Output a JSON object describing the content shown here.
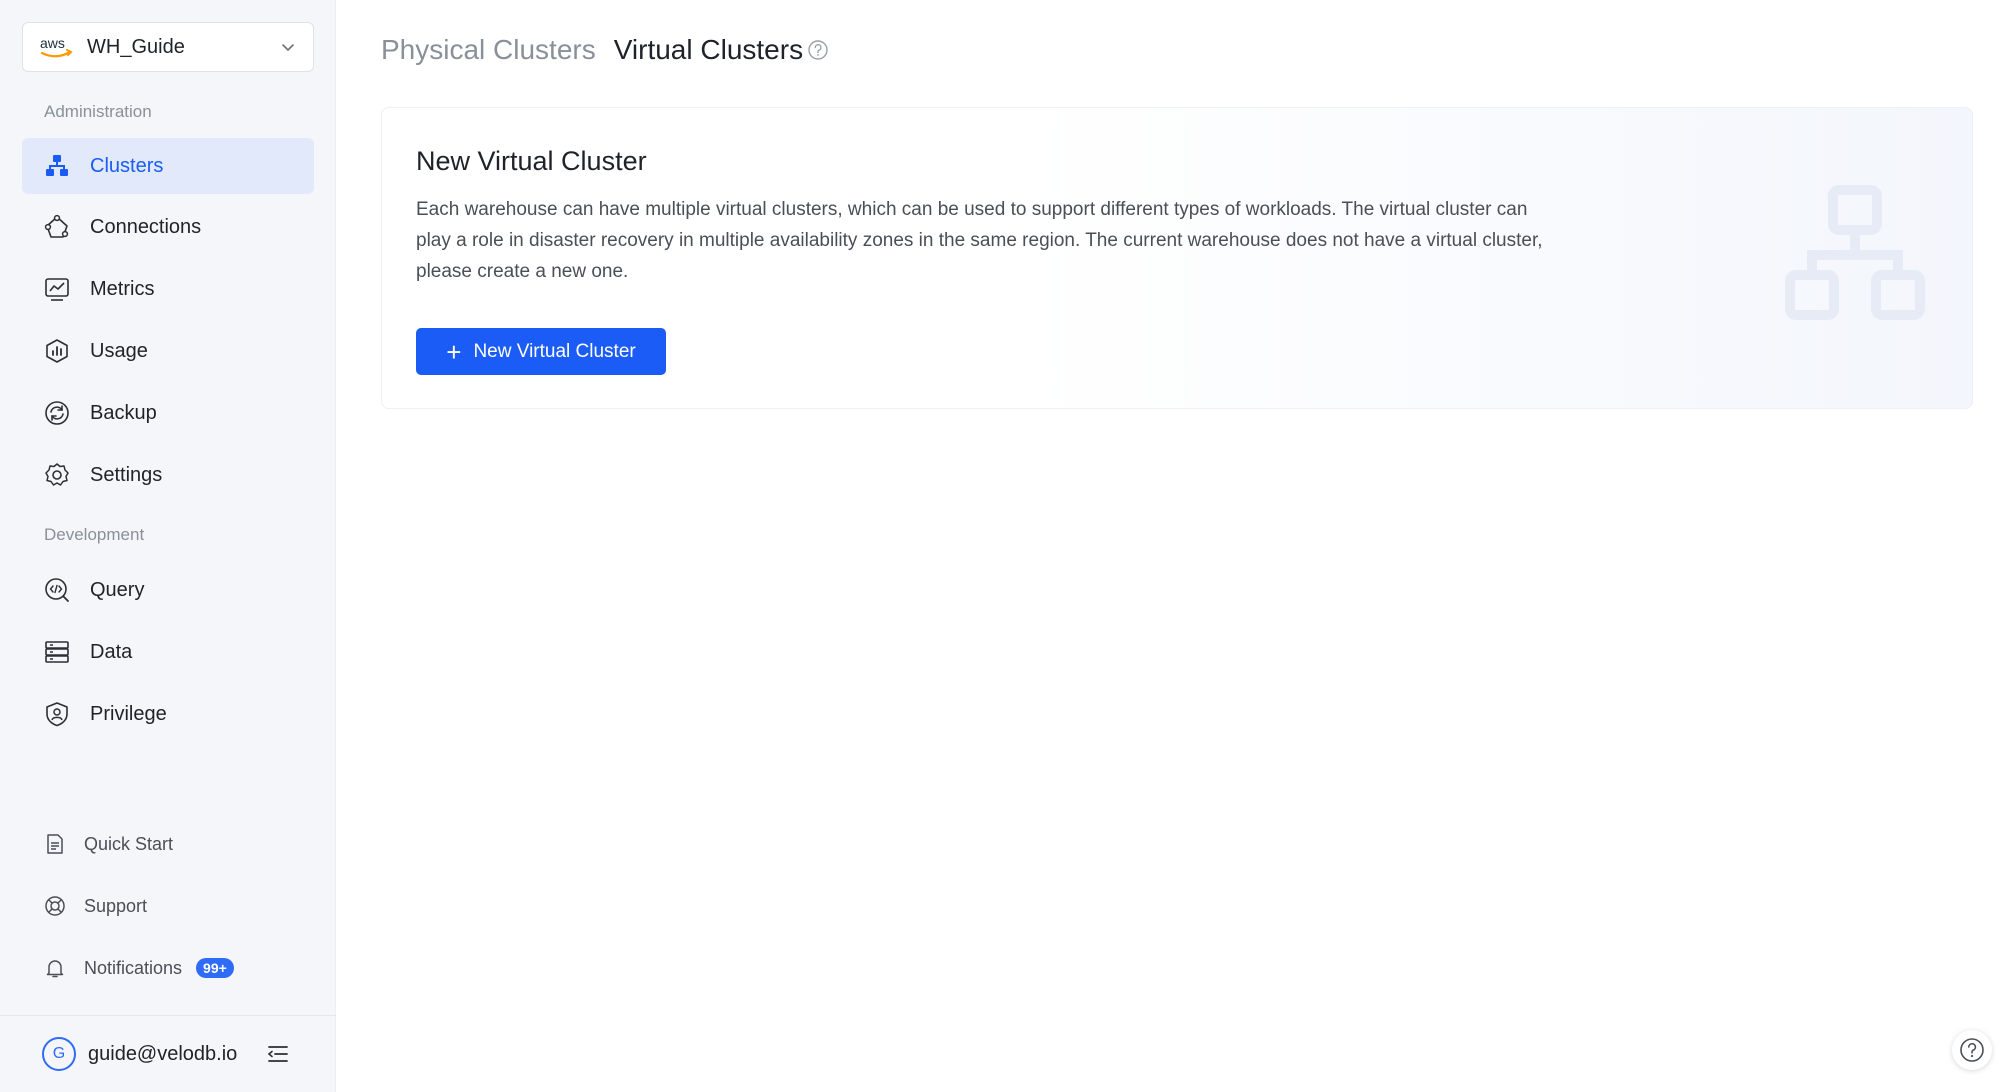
{
  "workspace": {
    "provider": "aws",
    "name": "WH_Guide"
  },
  "sidebar": {
    "sections": {
      "administration": "Administration",
      "development": "Development"
    },
    "admin_items": [
      {
        "label": "Clusters",
        "icon": "clusters-icon",
        "active": true
      },
      {
        "label": "Connections",
        "icon": "connections-icon"
      },
      {
        "label": "Metrics",
        "icon": "metrics-icon"
      },
      {
        "label": "Usage",
        "icon": "usage-icon"
      },
      {
        "label": "Backup",
        "icon": "backup-icon"
      },
      {
        "label": "Settings",
        "icon": "gear-icon"
      }
    ],
    "dev_items": [
      {
        "label": "Query",
        "icon": "query-icon"
      },
      {
        "label": "Data",
        "icon": "database-icon"
      },
      {
        "label": "Privilege",
        "icon": "shield-user-icon"
      }
    ],
    "util_items": [
      {
        "label": "Quick Start",
        "icon": "document-icon"
      },
      {
        "label": "Support",
        "icon": "lifebuoy-icon"
      },
      {
        "label": "Notifications",
        "icon": "bell-icon",
        "badge": "99+"
      }
    ]
  },
  "user": {
    "initial": "G",
    "email": "guide@velodb.io"
  },
  "header": {
    "tabs": [
      {
        "label": "Physical Clusters",
        "active": false
      },
      {
        "label": "Virtual Clusters",
        "active": true
      }
    ]
  },
  "card": {
    "title": "New Virtual Cluster",
    "description": "Each warehouse can have multiple virtual clusters, which can be used to support different types of workloads. The virtual cluster can play a role in disaster recovery in multiple availability zones in the same region. The current warehouse does not have a virtual cluster, please create a new one.",
    "button_label": "New Virtual Cluster"
  },
  "colors": {
    "accent": "#1a5cf5",
    "active_bg": "#e1e9fb",
    "sidebar_bg": "#f5f6fa",
    "badge": "#2e6bf6"
  }
}
